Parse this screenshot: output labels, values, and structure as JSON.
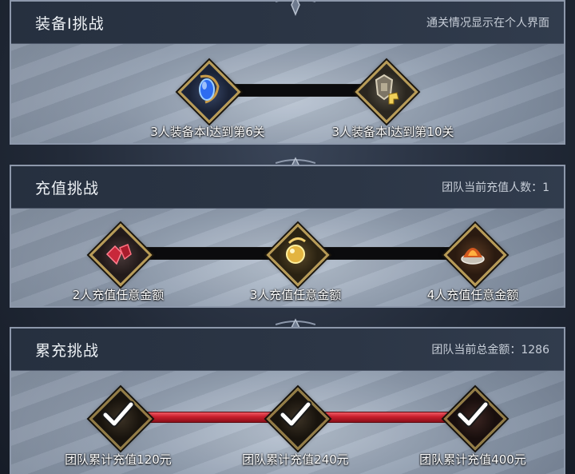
{
  "panels": [
    {
      "title": "装备I挑战",
      "info": "通关情况显示在个人界面",
      "nodes": [
        {
          "icon": "blue-gem-icon",
          "label": "3人装备本I达到第6关"
        },
        {
          "icon": "armor-set-icon",
          "label": "3人装备本I达到第10关"
        }
      ]
    },
    {
      "title": "充值挑战",
      "info": "团队当前充值人数：1",
      "nodes": [
        {
          "icon": "red-crystal-icon",
          "label": "2人充值任意金额"
        },
        {
          "icon": "gold-orb-icon",
          "label": "3人充值任意金额"
        },
        {
          "icon": "fire-cauldron-icon",
          "label": "4人充值任意金额"
        }
      ]
    },
    {
      "title": "累充挑战",
      "info": "团队当前总金额：1286",
      "nodes": [
        {
          "icon": "claimed-reward-icon",
          "label": "团队累计充值120元",
          "claimed": true
        },
        {
          "icon": "claimed-reward-icon",
          "label": "团队累计充值240元",
          "claimed": true
        },
        {
          "icon": "claimed-reward-icon",
          "label": "团队累计充值400元",
          "claimed": true
        }
      ]
    }
  ],
  "colors": {
    "frame_gold": "#b79a55",
    "progress_red": "#c81e2c",
    "header_bg": "#26303f"
  }
}
